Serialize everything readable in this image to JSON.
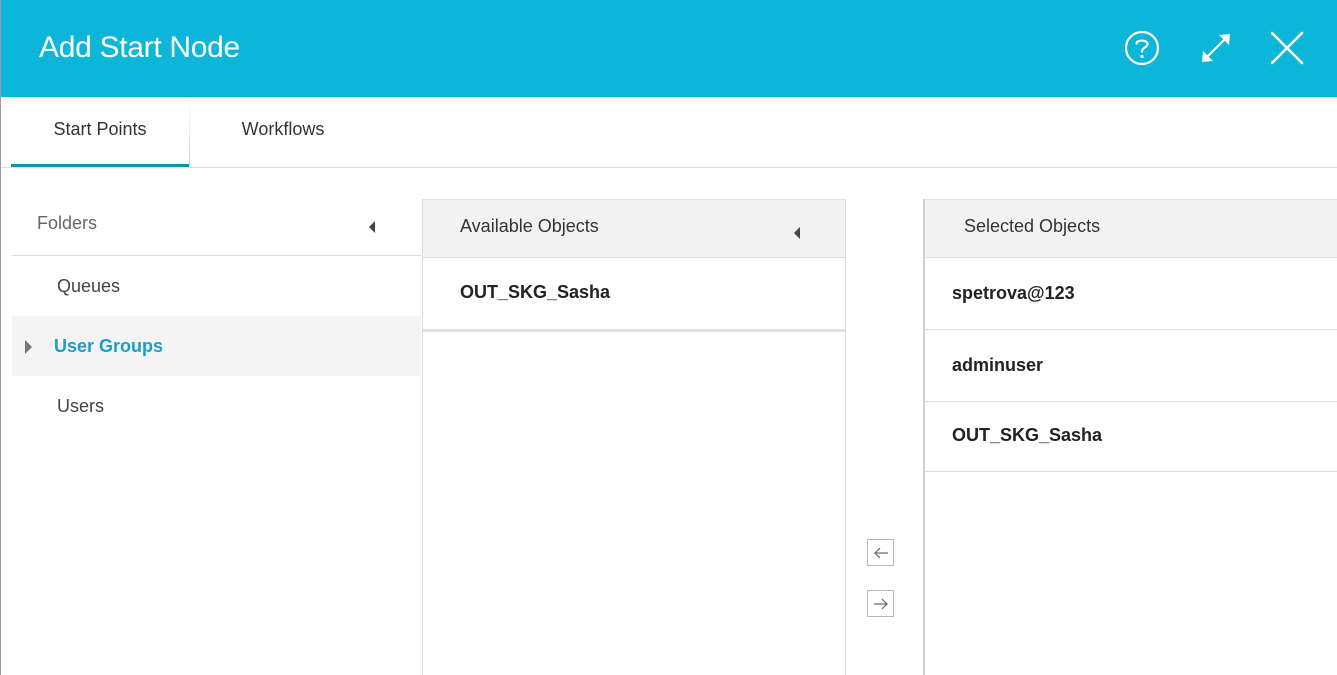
{
  "dialog": {
    "title": "Add Start Node",
    "accent_color": "#0bb6d8"
  },
  "titlebar": {
    "icons": [
      "help-icon",
      "maximize-icon",
      "close-icon"
    ]
  },
  "tabs": [
    {
      "label": "Start Points",
      "active": true
    },
    {
      "label": "Workflows",
      "active": false
    }
  ],
  "folders": {
    "header": "Folders",
    "items": [
      {
        "label": "Queues",
        "selected": false
      },
      {
        "label": "User Groups",
        "selected": true
      },
      {
        "label": "Users",
        "selected": false
      }
    ]
  },
  "available": {
    "header": "Available Objects",
    "items": [
      "OUT_SKG_Sasha"
    ]
  },
  "selected": {
    "header": "Selected Objects",
    "items": [
      "spetrova@123",
      "adminuser",
      "OUT_SKG_Sasha"
    ]
  },
  "transfer": {
    "icons": [
      "arrow-left-icon",
      "arrow-right-icon"
    ]
  }
}
